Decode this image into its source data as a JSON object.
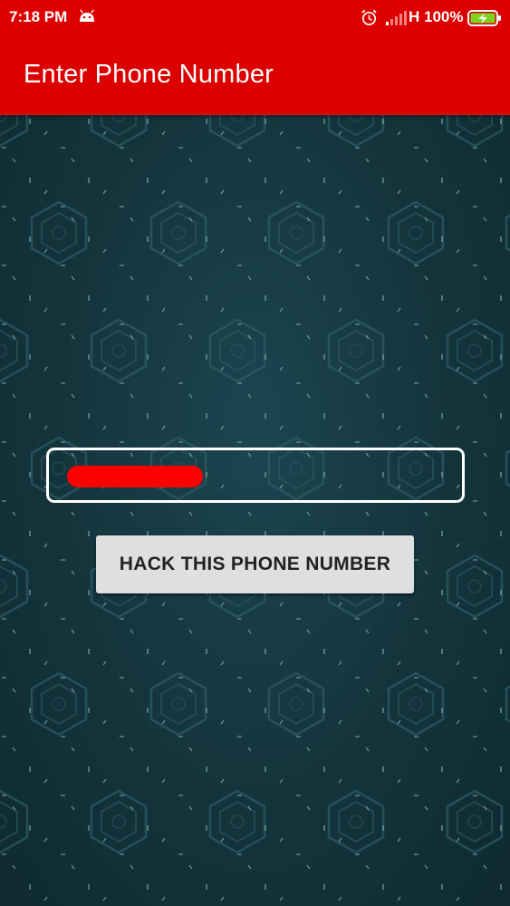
{
  "status_bar": {
    "time": "7:18 PM",
    "network_type": "H",
    "battery_percent": "100%",
    "icons": [
      "android-notification-icon",
      "alarm-icon",
      "signal-icon",
      "battery-charging-icon"
    ]
  },
  "app_bar": {
    "title": "Enter Phone Number",
    "color": "#dd0000"
  },
  "form": {
    "phone_input": {
      "value": "",
      "placeholder": "",
      "value_redacted": true,
      "redaction_color": "#ff0000"
    },
    "hack_button_label": "HACK THIS PHONE NUMBER"
  },
  "theme": {
    "background": "#14343b",
    "button_bg": "#dedfe1"
  }
}
